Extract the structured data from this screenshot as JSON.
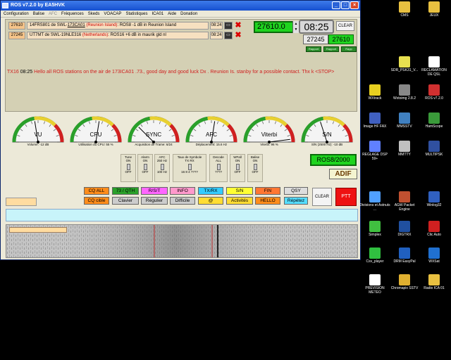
{
  "window": {
    "title": "ROS v7.2.0 by EA5HVK",
    "menu": [
      "Configuration",
      "Balise",
      "AFC",
      "Fréquences",
      "Skeds",
      "VOACAP",
      "Statistiques",
      "ICA01",
      "Aide",
      "Donation"
    ]
  },
  "messages": [
    {
      "id": "27610",
      "text_prefix": "14FRS801 de SWL-",
      "call": "173CA01",
      "country": "(Reunion Island)",
      "text_suffix": ": ROS8 -1 dB in Reunion Island",
      "time": "08:24"
    },
    {
      "id": "27245",
      "text_prefix": "UT7MT de SWL-19NLE316 ",
      "call": "",
      "country": "(Netherlands)",
      "text_suffix": ": ROS16 +6 dB in maurik gld nl",
      "time": "08:24"
    }
  ],
  "status": {
    "frequency": "27610.0",
    "clock": "08:25",
    "clear_label": "CLEAR",
    "freq_a": "27245",
    "freq_b": "27610",
    "mini_buttons": [
      "Rapport",
      "Rapport",
      "Rapp"
    ]
  },
  "rx": {
    "prefix": "TX16",
    "time": "08:25",
    "text": " Hello all ROS stations on the air de 173ICA01 .73., good day and good luck Dx . Reunion Is. stanby for a possible contact. Thx k <STOP>"
  },
  "gauges": [
    {
      "name": "VU",
      "caption": "Volume: -12 dB",
      "level": 0.45
    },
    {
      "name": "CPU",
      "caption": "Utilisation du CPU: 55 %",
      "level": 0.55
    },
    {
      "name": "SYNC",
      "caption": "Acquisition de Trame: 6/24",
      "level": 0.25
    },
    {
      "name": "AFC",
      "caption": "Déplacement: 15.6 Hz",
      "level": 0.55
    },
    {
      "name": "Viterbi",
      "caption": "Viterbi: 96 %",
      "level": 0.96
    },
    {
      "name": "S/N",
      "caption": "S/N (2500 Hz): -10 dB",
      "level": 0.4
    }
  ],
  "settings": [
    {
      "title": "Tune",
      "top": "ON",
      "bottom": "OFF"
    },
    {
      "title": "Alarm",
      "top": "ON",
      "bottom": "OFF"
    },
    {
      "title": "AFC",
      "top": "250 Hz",
      "bottom": "100 Hz"
    },
    {
      "title": "Taux de Symbole",
      "top": "TX   RX",
      "bottom": "16 8 4 ????"
    },
    {
      "title": "Decode",
      "top": "ALL",
      "bottom": "????"
    },
    {
      "title": "WFall",
      "top": "ON",
      "bottom": "OFF"
    },
    {
      "title": "Balise",
      "top": "ON",
      "bottom": "OFF"
    }
  ],
  "mode_badge": "ROS8/2000",
  "adif_label": "ADIF",
  "macros": {
    "row1": [
      {
        "label": "CQ ALL",
        "color": "#ff8c1a"
      },
      {
        "label": "73 / QTH",
        "color": "#2aa02a"
      },
      {
        "label": "R/S/T",
        "color": "#ff66ff"
      },
      {
        "label": "INFO",
        "color": "#ff99cc"
      },
      {
        "label": "TX/RX",
        "color": "#33ccff"
      },
      {
        "label": "S/N",
        "color": "#ffff33"
      },
      {
        "label": "FIN",
        "color": "#ff7733"
      },
      {
        "label": "QSY",
        "color": "#dddddd"
      }
    ],
    "row2": [
      {
        "label": "CQ cible",
        "color": "#ff8c1a"
      },
      {
        "label": "Clavier",
        "color": "#cccccc"
      },
      {
        "label": "Régulier",
        "color": "#cccccc"
      },
      {
        "label": "Difficile",
        "color": "#cccccc"
      },
      {
        "label": "@",
        "color": "#ffdd33"
      },
      {
        "label": "Activités",
        "color": "#ffdd33"
      },
      {
        "label": "HELLO",
        "color": "#ff8c1a"
      },
      {
        "label": "Répétez",
        "color": "#55ddff"
      }
    ],
    "clear_label": "CLEAR",
    "ptt_label": "PTT"
  },
  "desktop_icons": [
    {
      "label": "CMS",
      "color": "#e8c040"
    },
    {
      "label": "JEUX",
      "color": "#e8c040"
    },
    {
      "label": "SDR_PSK31_V...",
      "color": "#e8e050"
    },
    {
      "label": "RECLAMATION DE QSL",
      "color": "#ffffff"
    },
    {
      "label": "WXtrack",
      "color": "#e8d020"
    },
    {
      "label": "Wxtoimg 2.8.2",
      "color": "#888888"
    },
    {
      "label": "ROS v7.2.0",
      "color": "#d03030"
    },
    {
      "label": "Image HF FAX",
      "color": "#4060c0"
    },
    {
      "label": "MMSSTV",
      "color": "#4080c0"
    },
    {
      "label": "HamScope",
      "color": "#3a9a3a"
    },
    {
      "label": "REGLAGE DSP 59+",
      "color": "#6080ff"
    },
    {
      "label": "MMTTY",
      "color": "#c0c0c0"
    },
    {
      "label": "MULTIPSK",
      "color": "#3050a0"
    },
    {
      "label": "Divisions et Astnuts ...",
      "color": "#50a0ff"
    },
    {
      "label": "AGW Packet Engine",
      "color": "#c05030"
    },
    {
      "label": "Winlog32",
      "color": "#3060c0"
    },
    {
      "label": "Simplex",
      "color": "#40c040"
    },
    {
      "label": "DIGTRX",
      "color": "#2050a0"
    },
    {
      "label": "Clic Auto",
      "color": "#d02020"
    },
    {
      "label": "Csv_player",
      "color": "#30c040"
    },
    {
      "label": "DRM EasyPal",
      "color": "#2060c0"
    },
    {
      "label": "WXSat",
      "color": "#2070d0"
    },
    {
      "label": "PREVISION METEO",
      "color": "#ffffff"
    },
    {
      "label": "Chromapix SSTV",
      "color": "#e0b030"
    },
    {
      "label": "Radio ICA 01",
      "color": "#e8c040"
    }
  ]
}
